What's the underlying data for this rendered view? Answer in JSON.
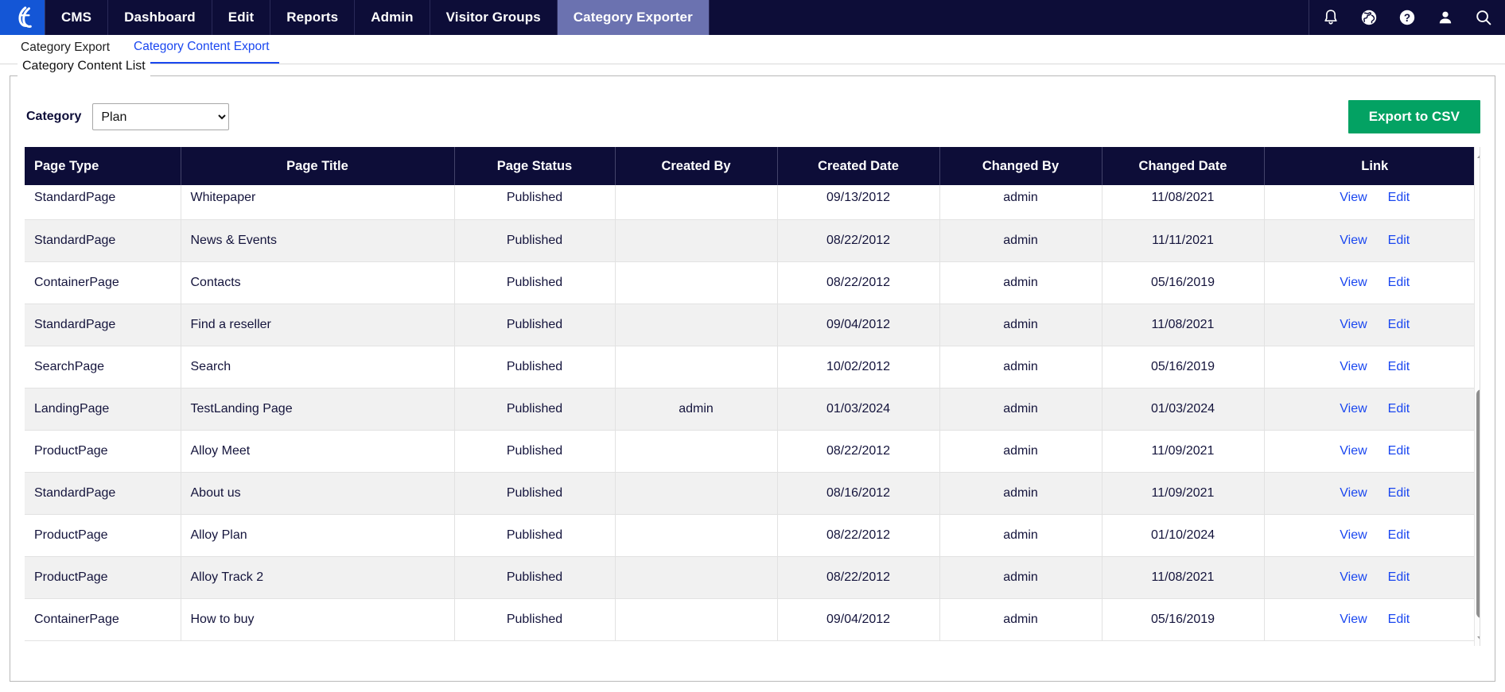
{
  "topnav": {
    "logo_name": "episerver-logo",
    "items": [
      {
        "label": "CMS",
        "active": false
      },
      {
        "label": "Dashboard",
        "active": false
      },
      {
        "label": "Edit",
        "active": false
      },
      {
        "label": "Reports",
        "active": false
      },
      {
        "label": "Admin",
        "active": false
      },
      {
        "label": "Visitor Groups",
        "active": false
      },
      {
        "label": "Category Exporter",
        "active": true
      }
    ],
    "icons": [
      {
        "name": "bell-icon"
      },
      {
        "name": "globe-icon"
      },
      {
        "name": "help-circle-icon"
      },
      {
        "name": "user-icon"
      },
      {
        "name": "search-icon"
      }
    ],
    "active_bg": "#6b72b0",
    "bar_bg": "#0d0d38",
    "logo_bg": "#1456d6"
  },
  "subtabs": [
    {
      "label": "Category Export",
      "active": false
    },
    {
      "label": "Category Content Export",
      "active": true
    }
  ],
  "panel": {
    "legend": "Category Content List"
  },
  "controls": {
    "category_label": "Category",
    "category_value": "Plan",
    "category_options": [
      "Plan"
    ],
    "export_label": "Export to CSV",
    "export_color": "#03a263"
  },
  "table": {
    "columns": [
      "Page Type",
      "Page Title",
      "Page Status",
      "Created By",
      "Created Date",
      "Changed By",
      "Changed Date",
      "Link"
    ],
    "link_labels": {
      "view": "View",
      "edit": "Edit"
    },
    "link_color": "#1a47f0",
    "header_bg": "#0d0d38",
    "rows": [
      {
        "page_type": "StandardPage",
        "page_title": "Whitepaper",
        "page_status": "Published",
        "created_by": "",
        "created_date": "09/13/2012",
        "changed_by": "admin",
        "changed_date": "11/08/2021"
      },
      {
        "page_type": "StandardPage",
        "page_title": "News & Events",
        "page_status": "Published",
        "created_by": "",
        "created_date": "08/22/2012",
        "changed_by": "admin",
        "changed_date": "11/11/2021"
      },
      {
        "page_type": "ContainerPage",
        "page_title": "Contacts",
        "page_status": "Published",
        "created_by": "",
        "created_date": "08/22/2012",
        "changed_by": "admin",
        "changed_date": "05/16/2019"
      },
      {
        "page_type": "StandardPage",
        "page_title": "Find a reseller",
        "page_status": "Published",
        "created_by": "",
        "created_date": "09/04/2012",
        "changed_by": "admin",
        "changed_date": "11/08/2021"
      },
      {
        "page_type": "SearchPage",
        "page_title": "Search",
        "page_status": "Published",
        "created_by": "",
        "created_date": "10/02/2012",
        "changed_by": "admin",
        "changed_date": "05/16/2019"
      },
      {
        "page_type": "LandingPage",
        "page_title": "TestLanding Page",
        "page_status": "Published",
        "created_by": "admin",
        "created_date": "01/03/2024",
        "changed_by": "admin",
        "changed_date": "01/03/2024"
      },
      {
        "page_type": "ProductPage",
        "page_title": "Alloy Meet",
        "page_status": "Published",
        "created_by": "",
        "created_date": "08/22/2012",
        "changed_by": "admin",
        "changed_date": "11/09/2021"
      },
      {
        "page_type": "StandardPage",
        "page_title": "About us",
        "page_status": "Published",
        "created_by": "",
        "created_date": "08/16/2012",
        "changed_by": "admin",
        "changed_date": "11/09/2021"
      },
      {
        "page_type": "ProductPage",
        "page_title": "Alloy Plan",
        "page_status": "Published",
        "created_by": "",
        "created_date": "08/22/2012",
        "changed_by": "admin",
        "changed_date": "01/10/2024"
      },
      {
        "page_type": "ProductPage",
        "page_title": "Alloy Track 2",
        "page_status": "Published",
        "created_by": "",
        "created_date": "08/22/2012",
        "changed_by": "admin",
        "changed_date": "11/08/2021"
      },
      {
        "page_type": "ContainerPage",
        "page_title": "How to buy",
        "page_status": "Published",
        "created_by": "",
        "created_date": "09/04/2012",
        "changed_by": "admin",
        "changed_date": "05/16/2019"
      }
    ]
  },
  "scrollbar": {
    "up_arrow": "scroll-up-arrow",
    "down_arrow": "scroll-down-arrow",
    "thumb": "scroll-thumb"
  }
}
